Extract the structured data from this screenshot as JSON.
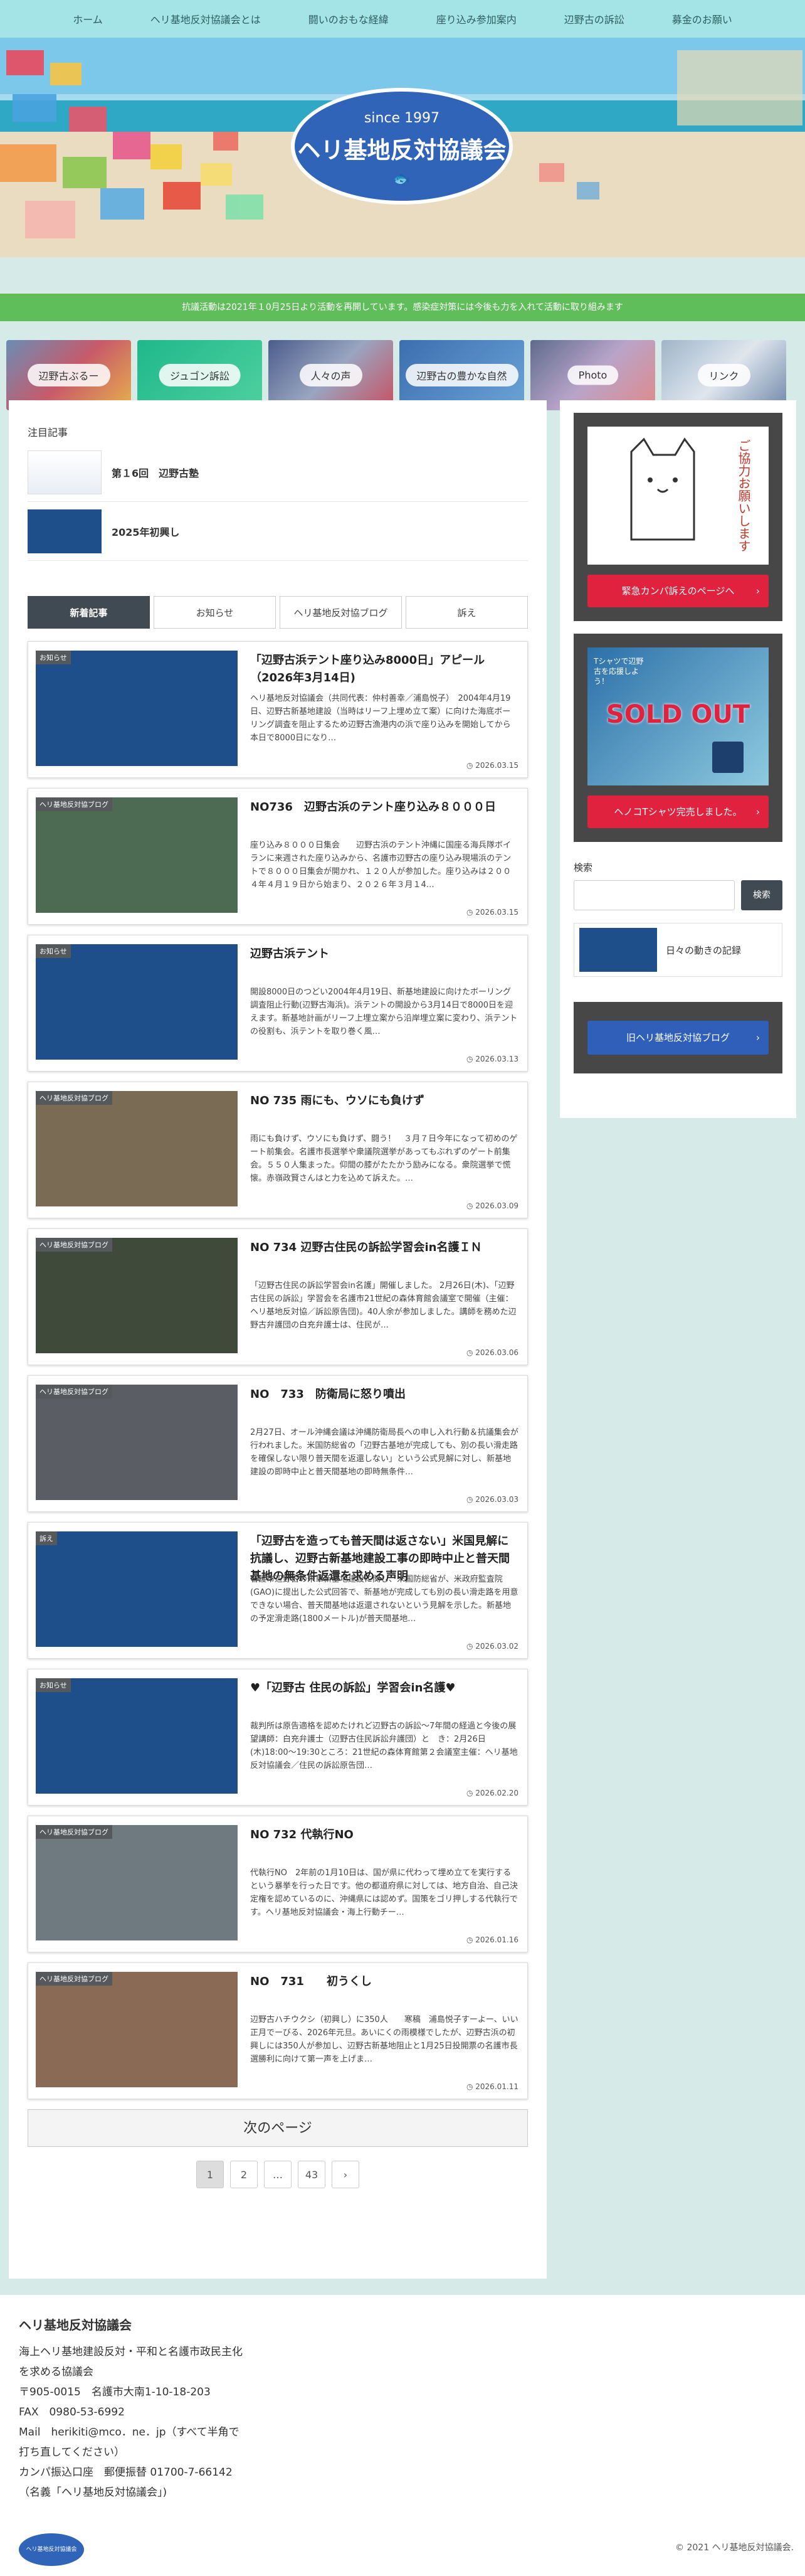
{
  "nav": [
    "ホーム",
    "ヘリ基地反対協議会とは",
    "闘いのおもな経緯",
    "座り込み参加案内",
    "辺野古の訴訟",
    "募金のお願い"
  ],
  "hero": {
    "since": "since 1997",
    "title": "ヘリ基地反対協議会",
    "fish": "🐟"
  },
  "notice": "抗議活動は2021年１0月25日より活動を再開しています。感染症対策には今後も力を入れて活動に取り組みます",
  "categories": [
    "辺野古ぶるー",
    "ジュゴン訴訟",
    "人々の声",
    "辺野古の豊かな自然",
    "Photo",
    "リンク"
  ],
  "featured": {
    "heading": "注目記事",
    "items": [
      "第１6回　辺野古塾",
      "2025年初興し"
    ]
  },
  "tabs": [
    "新着記事",
    "お知らせ",
    "ヘリ基地反対協ブログ",
    "訴え"
  ],
  "posts": [
    {
      "tag": "お知らせ",
      "title": "「辺野古浜テント座り込み8000日」アピール（2026年3月14日)",
      "excerpt": "ヘリ基地反対協議会（共同代表：仲村善幸／浦島悦子）　2004年4月19日、辺野古新基地建設（当時はリーフ上埋め立て案）に向けた海底ボーリング調査を阻止するため辺野古漁港内の浜で座り込みを開始してから本日で8000日になり…",
      "date": "2026.03.15"
    },
    {
      "tag": "ヘリ基地反対協ブログ",
      "title": "NO736　辺野古浜のテント座り込み８０００日",
      "excerpt": "座り込み８０００日集会　　辺野古浜のテント沖縄に国座る海兵隊ボイランに来週された座り込みから、名護市辺野古の座り込み現場浜のテントで８０００日集会が開かれ、１２０人が参加した。座り込みは２００４年４月１９日から始まり、２０２６年３月１4…",
      "date": "2026.03.15"
    },
    {
      "tag": "お知らせ",
      "title": "辺野古浜テント",
      "excerpt": "開設8000日のつどい2004年4月19日、新基地建設に向けたボーリング調査阻止行動(辺野古海浜)。浜テントの開設から3月14日で8000日を迎えます。新基地計画がリーフ上埋立案から沿岸埋立案に変わり、浜テントの役割も、浜テントを取り巻く風…",
      "date": "2026.03.13"
    },
    {
      "tag": "ヘリ基地反対協ブログ",
      "title": "NO 735 雨にも、ウソにも負けず",
      "excerpt": "雨にも負けず、ウソにも負けず、闘う！　３月７日今年になって初めのゲート前集会。名護市長選挙や衆議院選挙があってもぶれずのゲート前集会。５５０人集まった。仰間の膝がたたかう励みになる。衆院選挙で慌懐。赤嶺政賢さんはと力を込めて訴えた。…",
      "date": "2026.03.09"
    },
    {
      "tag": "ヘリ基地反対協ブログ",
      "title": "NO 734 辺野古住民の訴訟学習会in名護ＩＮ",
      "excerpt": "「辺野古住民の訴訟学習会in名護」開催しました。 2月26日(木)、「辺野古住民の訴訟」学習会を名護市21世紀の森体育館会議室で開催（主催：ヘリ基地反対協／訴訟原告団)。40人余が参加しました。講師を務めた辺野古弁護団の白充弁護士は、住民が…",
      "date": "2026.03.06"
    },
    {
      "tag": "ヘリ基地反対協ブログ",
      "title": "NO　733　防衛局に怒り噴出",
      "excerpt": "2月27日、オール沖縄会議は沖縄防衛局長への申し入れ行動＆抗議集会が行われました。米国防総省の「辺野古基地が完成しても、別の長い滑走路を確保しない限り普天間を返還しない」という公式見解に対し、新基地建設の即時中止と普天間基地の即時無条件…",
      "date": "2026.03.03"
    },
    {
      "tag": "訴え",
      "title": "「辺野古を造っても普天間は返さない」米国見解に抗議し、辺野古新基地建設工事の即時中止と普天間基地の無条件返還を求める声明",
      "excerpt": "名護市辺野古の米軍新基地建設に関し、米国防総省が、米政府監査院(GAO)に提出した公式回答で、新基地が完成しても別の長い滑走路を用意できない場合、普天間基地は返還されないという見解を示した。新基地の予定滑走路(1800メートル)が普天間基地…",
      "date": "2026.03.02"
    },
    {
      "tag": "お知らせ",
      "title": "♥「辺野古 住民の訴訟」学習会in名護♥",
      "excerpt": "裁判所は原告適格を認めたけれど辺野古の訴訟～7年間の経過と今後の展望講師：白充弁護士（辺野古住民訴訟弁護団）と　き：2月26日(木)18:00～19:30ところ：21世紀の森体育館第２会議室主催：ヘリ基地反対協議会／住民の訴訟原告団…",
      "date": "2026.02.20"
    },
    {
      "tag": "ヘリ基地反対協ブログ",
      "title": "NO 732 代執行NO",
      "excerpt": "代執行NO　2年前の1月10日は、国が県に代わって埋め立てを実行するという暴挙を行った日です。他の都道府県に対しては、地方自治、自己決定権を認めているのに、沖縄県には認めず。国策をゴリ押しする代執行です。ヘリ基地反対協議会・海上行動チー…",
      "date": "2026.01.16"
    },
    {
      "tag": "ヘリ基地反対協ブログ",
      "title": "NO　731　　初うくし",
      "excerpt": "辺野古ハチウクシ（初興し）に350人　　寒稿　浦島悦子すーよー、いい正月でーびる、2026年元旦。あいにくの雨模様でしたが、辺野古浜の初興しには350人が参加し、辺野古新基地阻止と1月25日投開票の名護市長選勝利に向けて第一声を上げま…",
      "date": "2026.01.11"
    }
  ],
  "next_page": "次のページ",
  "pager": [
    "1",
    "2",
    "…",
    "43",
    "›"
  ],
  "sidebar": {
    "kanpa_button": "緊急カンパ訴えのページへ",
    "kanpa_text": "ご協力お願いします",
    "shirt_button": "ヘノコTシャツ完売しました。",
    "shirt_text": "SOLD OUT",
    "shirt_caption": "Tシャツで辺野古を応援しよう！",
    "search_label": "検索",
    "search_button": "検索",
    "mini_post": "日々の動きの記録",
    "old_blog": "旧ヘリ基地反対協ブログ"
  },
  "footer": {
    "name": "ヘリ基地反対協議会",
    "lines": [
      "海上ヘリ基地建設反対・平和と名護市政民主化",
      "を求める協議会",
      "〒905-0015　名護市大南1-10-18-203",
      "FAX　0980-53-6992",
      "Mail　herikiti@mco．ne．jp（すべて半角で",
      "打ち直してください）",
      "カンパ振込口座　郵便振替 01700-7-66142",
      "（名義「ヘリ基地反対協議会」)"
    ],
    "copyright": "© 2021 ヘリ基地反対協議会.",
    "logo_text": "ヘリ基地反対協議会"
  },
  "colors": {
    "nav": "#a4e3e6",
    "notice": "#5fbd5a",
    "button_red": "#e1223f",
    "button_blue": "#2f5fb8",
    "bg": "#d6eae8"
  }
}
